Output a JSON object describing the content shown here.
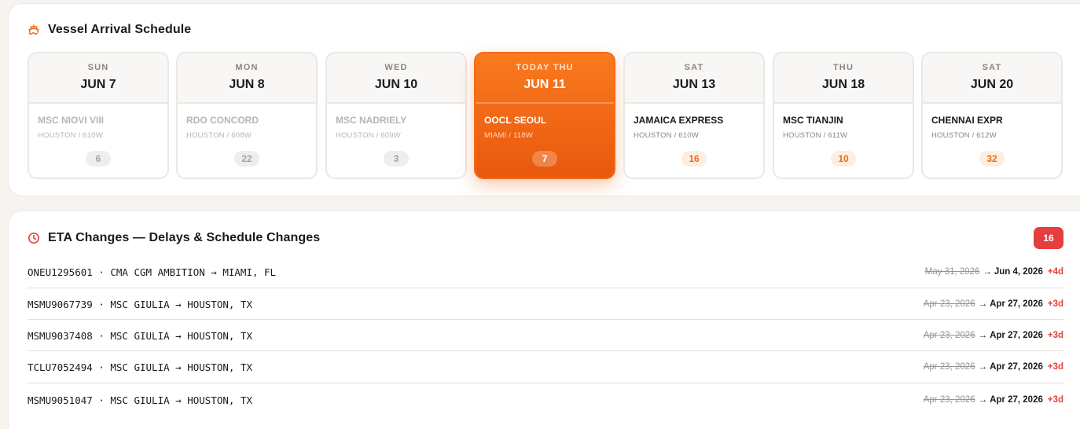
{
  "schedule": {
    "title": "Vessel Arrival Schedule",
    "icon": "ship-icon",
    "accent": "#f26c1a",
    "days": [
      {
        "day": "SUN",
        "date": "JUN 7",
        "vessel": "MSC NIOVI VIII",
        "route": "HOUSTON / 610W",
        "count": "6",
        "state": "past"
      },
      {
        "day": "MON",
        "date": "JUN 8",
        "vessel": "RDO CONCORD",
        "route": "HOUSTON / 608W",
        "count": "22",
        "state": "past"
      },
      {
        "day": "WED",
        "date": "JUN 10",
        "vessel": "MSC NADRIELY",
        "route": "HOUSTON / 609W",
        "count": "3",
        "state": "past"
      },
      {
        "day": "TODAY THU",
        "date": "JUN 11",
        "vessel": "OOCL SEOUL",
        "route": "MIAMI / 118W",
        "count": "7",
        "state": "today"
      },
      {
        "day": "SAT",
        "date": "JUN 13",
        "vessel": "JAMAICA EXPRESS",
        "route": "HOUSTON / 610W",
        "count": "16",
        "state": "future"
      },
      {
        "day": "THU",
        "date": "JUN 18",
        "vessel": "MSC TIANJIN",
        "route": "HOUSTON / 611W",
        "count": "10",
        "state": "future"
      },
      {
        "day": "SAT",
        "date": "JUN 20",
        "vessel": "CHENNAI EXPR",
        "route": "HOUSTON / 612W",
        "count": "32",
        "state": "future"
      }
    ]
  },
  "eta": {
    "title": "ETA Changes — Delays & Schedule Changes",
    "icon": "clock-icon",
    "badge": "16",
    "badge_color": "#e53e3e",
    "rows": [
      {
        "text": "ONEU1295601 · CMA CGM AMBITION → MIAMI, FL",
        "old_date": "May 31, 2026",
        "arrow": "→",
        "new_date": "Jun 4, 2026",
        "delta": "+4d"
      },
      {
        "text": "MSMU9067739 · MSC GIULIA → HOUSTON, TX",
        "old_date": "Apr 23, 2026",
        "arrow": "→",
        "new_date": "Apr 27, 2026",
        "delta": "+3d"
      },
      {
        "text": "MSMU9037408 · MSC GIULIA → HOUSTON, TX",
        "old_date": "Apr 23, 2026",
        "arrow": "→",
        "new_date": "Apr 27, 2026",
        "delta": "+3d"
      },
      {
        "text": "TCLU7052494 · MSC GIULIA → HOUSTON, TX",
        "old_date": "Apr 23, 2026",
        "arrow": "→",
        "new_date": "Apr 27, 2026",
        "delta": "+3d"
      },
      {
        "text": "MSMU9051047 · MSC GIULIA → HOUSTON, TX",
        "old_date": "Apr 23, 2026",
        "arrow": "→",
        "new_date": "Apr 27, 2026",
        "delta": "+3d"
      }
    ]
  }
}
